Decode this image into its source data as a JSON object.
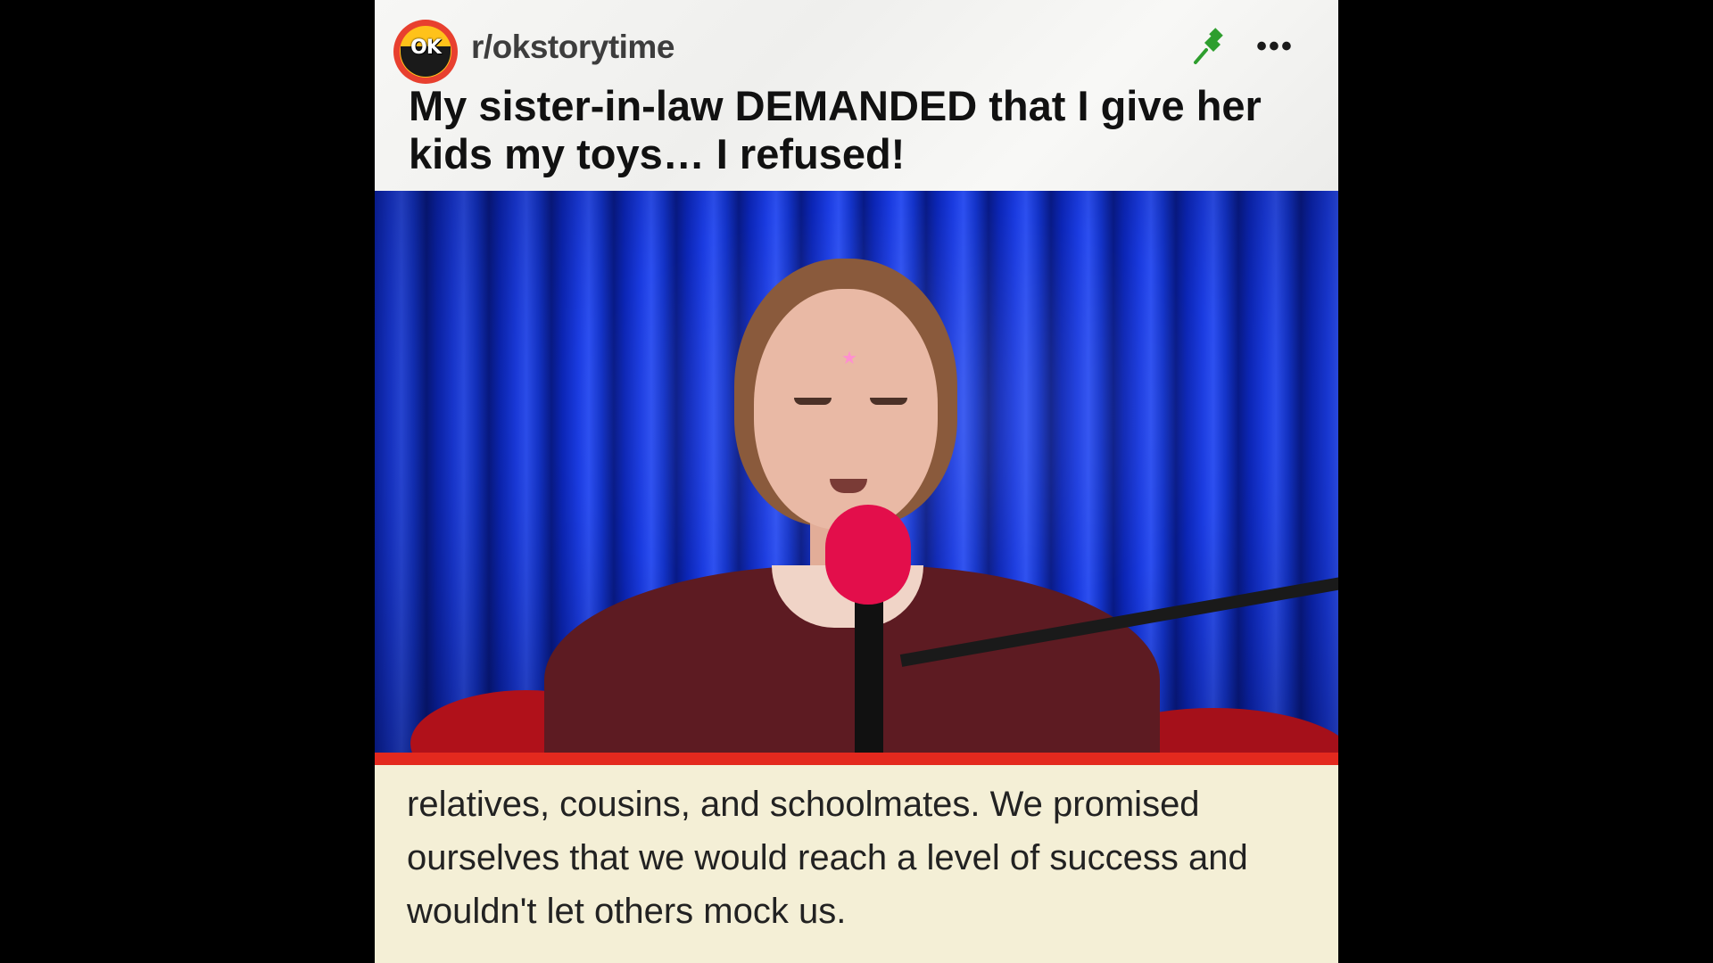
{
  "post": {
    "subreddit": "r/okstorytime",
    "logo_text": "OK",
    "title": "My sister-in-law DEMANDED that I give her kids my toys… I refused!",
    "more_label": "•••",
    "pin_icon": "pushpin-icon",
    "more_icon": "more-options-icon"
  },
  "caption": {
    "text": "relatives, cousins, and schoolmates. We promised ourselves that we would reach a level of success and wouldn't let others mock us."
  },
  "colors": {
    "background": "#000000",
    "header": "#f4f4f2",
    "accent_red": "#e3291e",
    "caption_bg": "#f4efd6",
    "curtain_blue": "#1a3be0",
    "pin_green": "#2e9e2e"
  }
}
